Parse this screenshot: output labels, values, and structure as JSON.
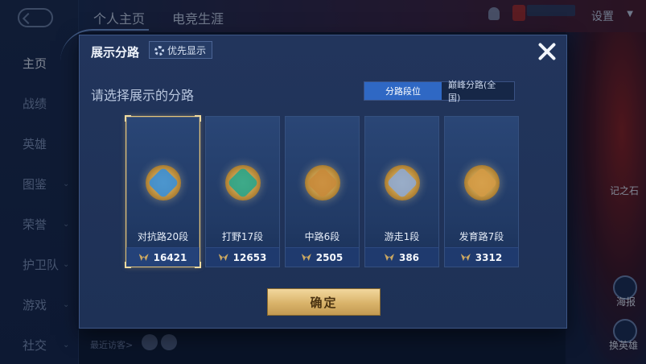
{
  "background": {
    "top_tabs": [
      "个人主页",
      "电竞生涯"
    ],
    "settings_label": "设置",
    "sidebar_items": [
      {
        "label": "主页",
        "has_chevron": false,
        "active": true
      },
      {
        "label": "战绩",
        "has_chevron": false,
        "active": false
      },
      {
        "label": "英雄",
        "has_chevron": false,
        "active": false
      },
      {
        "label": "图鉴",
        "has_chevron": true,
        "active": false
      },
      {
        "label": "荣誉",
        "has_chevron": true,
        "active": false
      },
      {
        "label": "护卫队",
        "has_chevron": true,
        "active": false
      },
      {
        "label": "游戏",
        "has_chevron": true,
        "active": false
      },
      {
        "label": "社交",
        "has_chevron": true,
        "active": false
      }
    ],
    "visitors_label": "最近访客>",
    "right_labels": {
      "poster": "海报",
      "switch_hero": "换英雄",
      "stone": "记之石"
    }
  },
  "modal": {
    "title": "展示分路",
    "priority_label": "优先显示",
    "prompt": "请选择展示的分路",
    "toggle": {
      "active": "分路段位",
      "inactive": "巅峰分路(全国)"
    },
    "confirm_label": "确定",
    "cards": [
      {
        "name": "对抗路20段",
        "score": "16421",
        "selected": true,
        "emblem_color": "#3a8fd6",
        "icon": "top-lane-icon"
      },
      {
        "name": "打野17段",
        "score": "12653",
        "selected": false,
        "emblem_color": "#2aa58a",
        "icon": "jungle-icon"
      },
      {
        "name": "中路6段",
        "score": "2505",
        "selected": false,
        "emblem_color": "#c88a3a",
        "icon": "mid-lane-icon"
      },
      {
        "name": "游走1段",
        "score": "386",
        "selected": false,
        "emblem_color": "#8fa9cf",
        "icon": "support-icon"
      },
      {
        "name": "发育路7段",
        "score": "3312",
        "selected": false,
        "emblem_color": "#d39a45",
        "icon": "bot-lane-icon"
      }
    ]
  },
  "colors": {
    "accent": "#2f68c4",
    "gold": "#e5c57a"
  }
}
